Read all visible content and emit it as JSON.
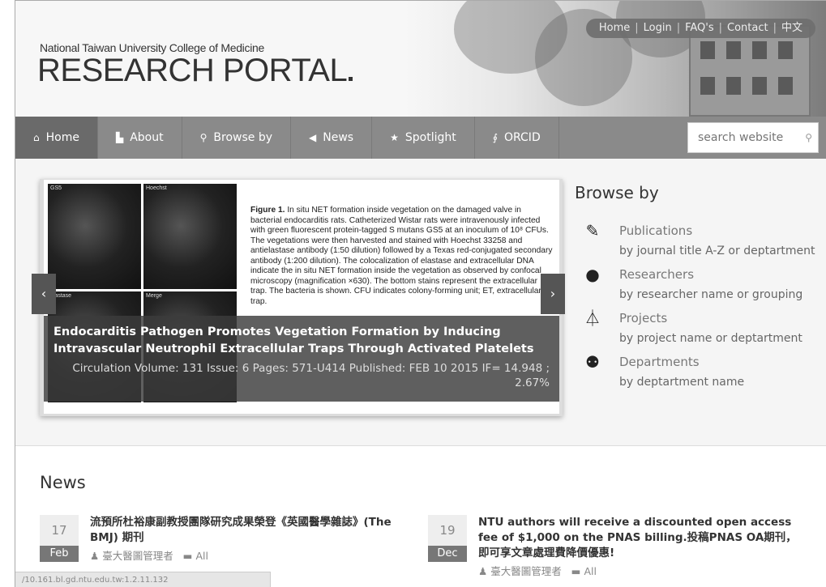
{
  "header": {
    "logo_small": "National Taiwan University College of Medicine",
    "logo_big": "RESEARCH PORTAL",
    "toplinks": [
      "Home",
      "Login",
      "FAQ's",
      "Contact",
      "中文"
    ]
  },
  "nav": {
    "items": [
      {
        "label": "Home",
        "icon": "home-icon",
        "glyph": "⌂"
      },
      {
        "label": "About",
        "icon": "file-icon",
        "glyph": "▙"
      },
      {
        "label": "Browse by",
        "icon": "search-icon",
        "glyph": "⚲"
      },
      {
        "label": "News",
        "icon": "megaphone-icon",
        "glyph": "◀"
      },
      {
        "label": "Spotlight",
        "icon": "star-icon",
        "glyph": "★"
      },
      {
        "label": "ORCID",
        "icon": "link-icon",
        "glyph": "∮"
      }
    ],
    "search_placeholder": "search website"
  },
  "slider": {
    "micro_labels": [
      "GS5",
      "Hoechst",
      "elastase",
      "Merge"
    ],
    "figure_label": "Figure 1.",
    "figure_text": "In situ NET formation inside vegetation on the damaged valve in bacterial endocarditis rats. Catheterized Wistar rats were intravenously infected with green fluorescent protein-tagged S mutans GS5 at an inoculum of 10⁸ CFUs. The vegetations were then harvested and stained with Hoechst 33258 and antielastase antibody (1:50 dilution) followed by a Texas red-conjugated secondary antibody (1:200 dilution). The colocalization of elastase and extracellular DNA indicate the in situ NET formation inside the vegetation as observed by confocal microscopy (magnification ×630). The bottom stains represent the extracellular trap. The bacteria is shown. CFU indicates colony-forming unit; ET, extracellular trap.",
    "title": "Endocarditis Pathogen Promotes Vegetation Formation by Inducing Intravascular Neutrophil Extracellular Traps Through Activated Platelets",
    "meta": "Circulation Volume: 131 Issue: 6 Pages: 571-U414 Published: FEB 10 2015 IF= 14.948 ; 2.67%",
    "prev": "‹",
    "next": "›"
  },
  "browse": {
    "title": "Browse by",
    "items": [
      {
        "label": "Publications",
        "desc": "by journal title A-Z or deptartment",
        "icon": "pencil-icon",
        "glyph": "✎"
      },
      {
        "label": "Researchers",
        "desc": "by researcher name or grouping",
        "icon": "user-icon",
        "glyph": "●"
      },
      {
        "label": "Projects",
        "desc": "by project name or deptartment",
        "icon": "flask-icon",
        "glyph": "⏃"
      },
      {
        "label": "Departments",
        "desc": "by deptartment name",
        "icon": "group-icon",
        "glyph": "⚉"
      }
    ]
  },
  "news": {
    "title": "News",
    "items": [
      {
        "day": "17",
        "month": "Feb",
        "text": "流預所杜裕康副教授團隊研究成果榮登《英國醫學雜誌》(The BMJ) 期刊",
        "author": "臺大醫圖管理者",
        "category": "All"
      },
      {
        "day": "19",
        "month": "Dec",
        "text": "NTU authors will receive a discounted open access fee of $1,000 on the PNAS billing.投稿PNAS OA期刊，即可享文章處理費降價優惠!",
        "author": "臺大醫圖管理者",
        "category": "All"
      }
    ]
  },
  "statusbar": "/10.161.bl.gd.ntu.edu.tw:1.2.11.132"
}
